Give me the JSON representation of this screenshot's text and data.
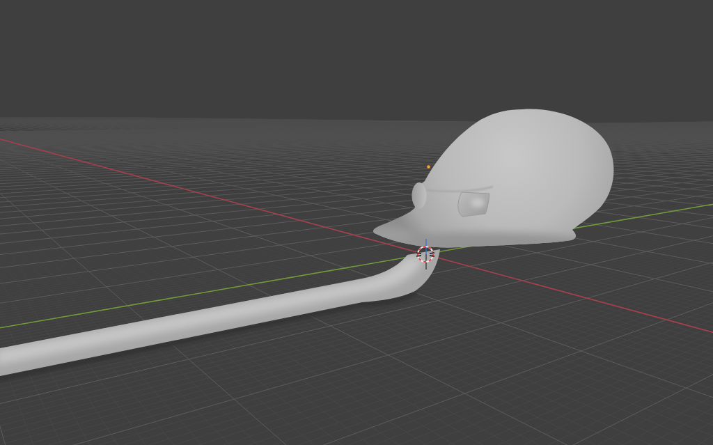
{
  "viewport": {
    "axis_lines": [
      {
        "color": "#a83f4c"
      },
      {
        "color": "#72993a"
      }
    ]
  }
}
